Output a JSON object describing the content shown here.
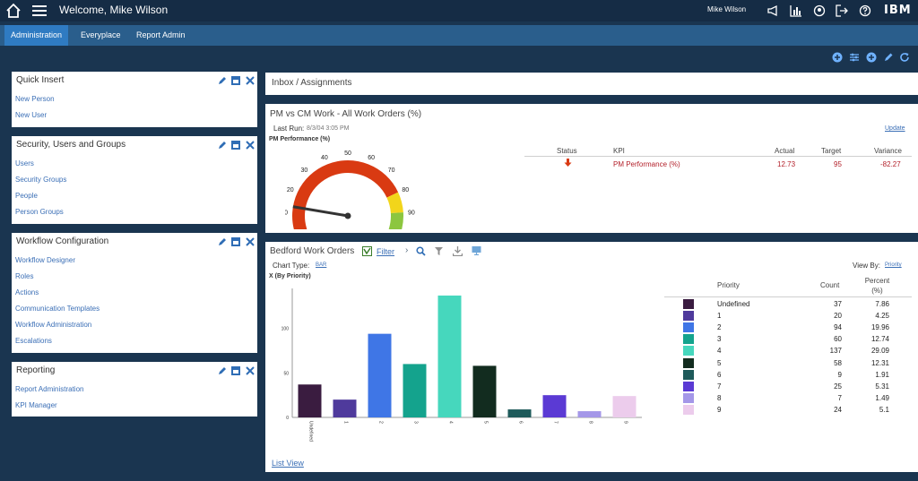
{
  "header": {
    "welcome": "Welcome, Mike Wilson",
    "user": "Mike Wilson",
    "brand": "IBM",
    "icons": [
      "home-icon",
      "menu-icon",
      "megaphone-icon",
      "chart-icon",
      "help-desk-icon",
      "logout-icon",
      "help-icon"
    ]
  },
  "nav": {
    "tabs": [
      "Administration",
      "Everyplace",
      "Report Admin"
    ],
    "active": 0
  },
  "toolbar_icons": [
    "add-icon",
    "settings-icon",
    "add-icon",
    "edit-icon",
    "refresh-icon"
  ],
  "left_panels": [
    {
      "title": "Quick Insert",
      "links": [
        "New Person",
        "New User"
      ]
    },
    {
      "title": "Security, Users and Groups",
      "links": [
        "Users",
        "Security Groups",
        "People",
        "Person Groups"
      ]
    },
    {
      "title": "Workflow Configuration",
      "links": [
        "Workflow Designer",
        "Roles",
        "Actions",
        "Communication Templates",
        "Workflow Administration",
        "Escalations"
      ]
    },
    {
      "title": "Reporting",
      "links": [
        "Report Administration",
        "KPI Manager"
      ]
    }
  ],
  "inbox": {
    "title": "Inbox / Assignments"
  },
  "kpi": {
    "title": "PM vs CM Work - All Work Orders (%)",
    "last_run_label": "Last Run:",
    "last_run_value": "8/3/04 3:05 PM",
    "update": "Update",
    "gauge_label": "PM Performance (%)",
    "gauge_ticks": [
      "0",
      "10",
      "20",
      "30",
      "40",
      "50",
      "60",
      "70",
      "80",
      "90",
      "100"
    ],
    "gauge_value": 12.73,
    "headers": {
      "status": "Status",
      "kpi": "KPI",
      "actual": "Actual",
      "target": "Target",
      "variance": "Variance"
    },
    "row": {
      "kpi": "PM Performance (%)",
      "actual": "12.73",
      "target": "95",
      "variance": "-82.27"
    },
    "colors": {
      "red": "#d93a12",
      "yellow": "#f2d51b",
      "green": "#8cc63f",
      "needle": "#333333"
    }
  },
  "orders": {
    "title": "Bedford Work Orders",
    "filter": "Filter",
    "chart_type_label": "Chart Type:",
    "chart_type_value": "BAR",
    "view_by_label": "View By:",
    "view_by_value": "Priority",
    "list_view": "List View",
    "table_headers": {
      "priority": "Priority",
      "count": "Count",
      "percent": "Percent (%)"
    },
    "rows": [
      {
        "priority": "Undefined",
        "count": "37",
        "percent": "7.86",
        "color": "#3a1c40"
      },
      {
        "priority": "1",
        "count": "20",
        "percent": "4.25",
        "color": "#4f3a9c"
      },
      {
        "priority": "2",
        "count": "94",
        "percent": "19.96",
        "color": "#3f76e6"
      },
      {
        "priority": "3",
        "count": "60",
        "percent": "12.74",
        "color": "#14a38d"
      },
      {
        "priority": "4",
        "count": "137",
        "percent": "29.09",
        "color": "#46d7bd"
      },
      {
        "priority": "5",
        "count": "58",
        "percent": "12.31",
        "color": "#122c1f"
      },
      {
        "priority": "6",
        "count": "9",
        "percent": "1.91",
        "color": "#1e5a5a"
      },
      {
        "priority": "7",
        "count": "25",
        "percent": "5.31",
        "color": "#5b3ad4"
      },
      {
        "priority": "8",
        "count": "7",
        "percent": "1.49",
        "color": "#a497e8"
      },
      {
        "priority": "9",
        "count": "24",
        "percent": "5.1",
        "color": "#ecccec"
      }
    ]
  },
  "chart_data": {
    "type": "bar",
    "ylabel": "X (By Priority)",
    "categories": [
      "Undefined",
      "1",
      "2",
      "3",
      "4",
      "5",
      "6",
      "7",
      "8",
      "9"
    ],
    "values": [
      37,
      20,
      94,
      60,
      137,
      58,
      9,
      25,
      7,
      24
    ],
    "colors": [
      "#3a1c40",
      "#4f3a9c",
      "#3f76e6",
      "#14a38d",
      "#46d7bd",
      "#122c1f",
      "#1e5a5a",
      "#5b3ad4",
      "#a497e8",
      "#ecccec"
    ],
    "yticks": [
      0,
      50,
      100
    ],
    "ylim": [
      0,
      145
    ]
  }
}
